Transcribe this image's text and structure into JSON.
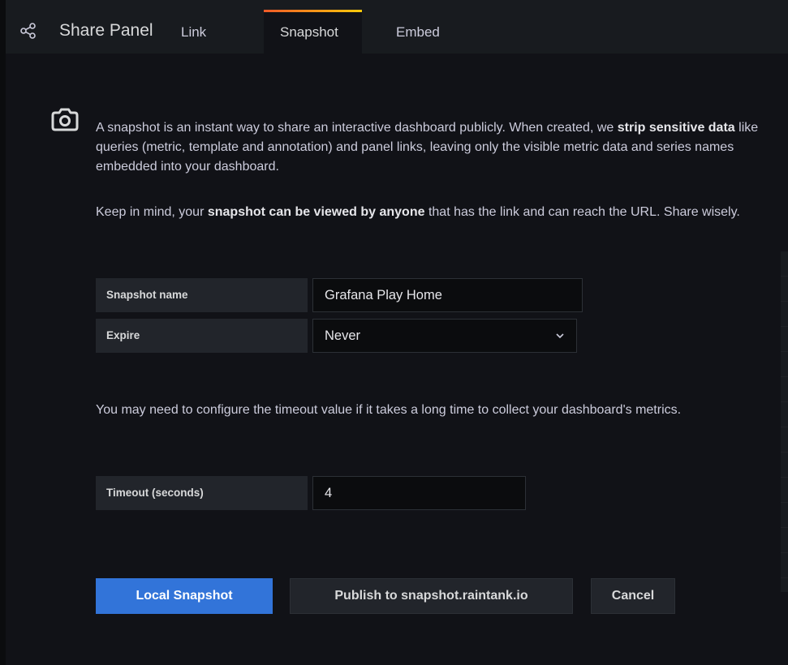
{
  "header": {
    "title": "Share Panel",
    "tabs": [
      {
        "label": "Link"
      },
      {
        "label": "Snapshot",
        "active": true
      },
      {
        "label": "Embed"
      }
    ],
    "icon": "share-icon"
  },
  "intro": {
    "icon": "camera-icon",
    "p1": {
      "t1": "A snapshot is an instant way to share an interactive dashboard publicly. When created, we ",
      "b1": "strip sensitive data",
      "t2": " like queries (metric, template and annotation) and panel links, leaving only the visible metric data and series names embedded into your dashboard."
    },
    "p2": {
      "t1": "Keep in mind, your ",
      "b1": "snapshot can be viewed by anyone",
      "t2": " that has the link and can reach the URL. Share wisely."
    }
  },
  "form": {
    "name_label": "Snapshot name",
    "name_value": "Grafana Play Home",
    "expire_label": "Expire",
    "expire_value": "Never",
    "timeout_note": "You may need to configure the timeout value if it takes a long time to collect your dashboard's metrics.",
    "timeout_label": "Timeout (seconds)",
    "timeout_value": "4"
  },
  "actions": {
    "local": "Local Snapshot",
    "publish": "Publish to snapshot.raintank.io",
    "cancel": "Cancel"
  },
  "colors": {
    "primary": "#3274d9",
    "tab_accent_start": "#f05a28",
    "tab_accent_end": "#fbca0a",
    "background": "#111217"
  }
}
